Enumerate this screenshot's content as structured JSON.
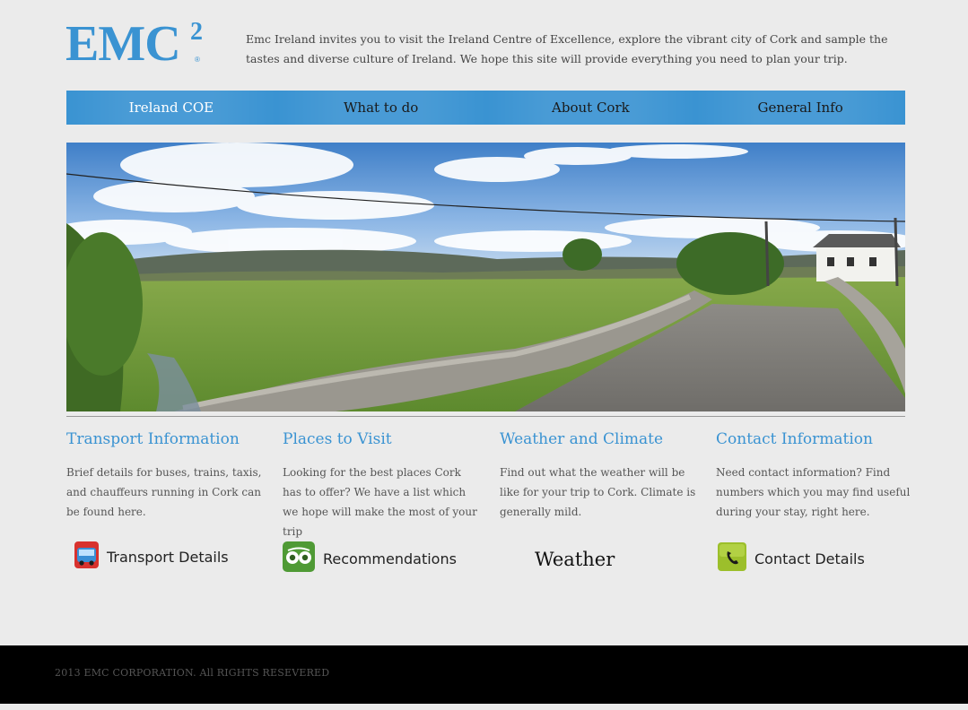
{
  "brand": {
    "logo_text": "EMC",
    "logo_sup": "2",
    "logo_reg": "®"
  },
  "intro": "Emc Ireland invites you to visit the Ireland Centre of Excellence, explore the vibrant city of Cork and sample the tastes and diverse culture of Ireland. We hope this site will provide everything you need to plan your trip.",
  "nav": {
    "items": [
      {
        "label": "Ireland COE",
        "active": true
      },
      {
        "label": "What to do",
        "active": false
      },
      {
        "label": "About Cork",
        "active": false
      },
      {
        "label": "General Info",
        "active": false
      }
    ]
  },
  "columns": [
    {
      "title": "Transport Information",
      "text": "Brief details for buses, trains, taxis, and chauffeurs running in Cork can be found here.",
      "link": "Transport Details",
      "icon": "bus-icon"
    },
    {
      "title": "Places to Visit",
      "text": "Looking for the best places Cork has to offer? We have a list which we hope will make the most of your trip",
      "link": "Recommendations",
      "icon": "tripadvisor-owl-icon"
    },
    {
      "title": "Weather and Climate",
      "text": "Find out what the weather will be like for your trip to Cork. Climate is generally mild.",
      "link": "Weather",
      "icon": ""
    },
    {
      "title": "Contact Information",
      "text": "Need contact information? Find numbers which you may find useful during your stay, right here.",
      "link": "Contact Details",
      "icon": "phone-icon"
    }
  ],
  "footer": {
    "copyright": "2013 EMC CORPORATION. All RIGHTS RESEVERED"
  },
  "colors": {
    "accent": "#3a93d2",
    "background": "#ebebeb",
    "footer": "#000000"
  }
}
